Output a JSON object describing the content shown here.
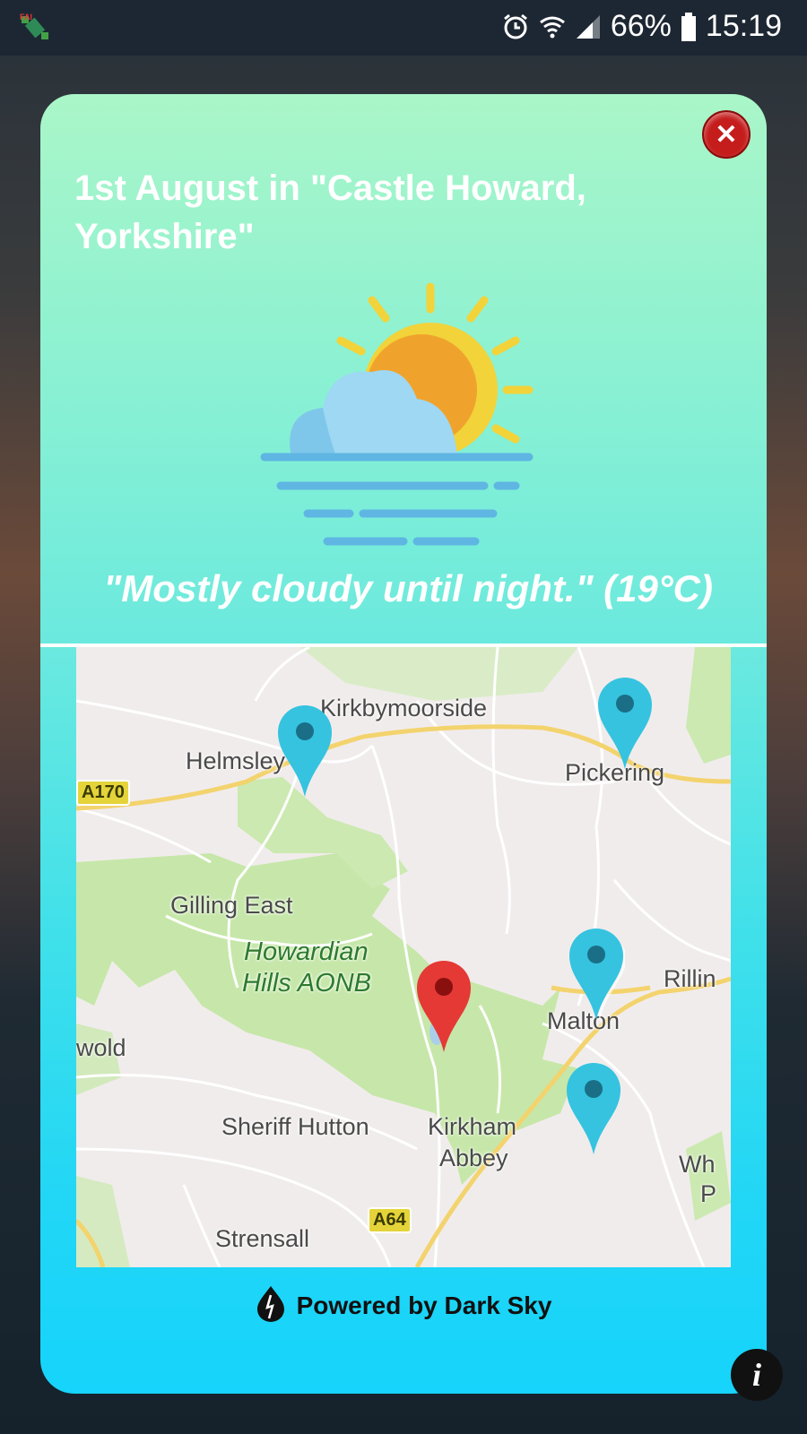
{
  "status_bar": {
    "app_icon": "satellite-icon",
    "alarm_icon": "alarm-clock-icon",
    "wifi_icon": "wifi-icon",
    "signal_icon": "signal-icon",
    "battery_percent": "66%",
    "battery_icon": "battery-icon",
    "time": "15:19"
  },
  "dialog": {
    "title": "1st August in \"Castle Howard, Yorkshire\"",
    "close_icon": "close-icon",
    "weather_icon": "sun-behind-cloud-fog-icon",
    "summary": "\"Mostly cloudy until night.\" (19°C)",
    "powered_by": "Powered by Dark Sky",
    "powered_icon": "dark-sky-logo-icon"
  },
  "map": {
    "places": {
      "kirkbymoorside": "Kirkbymoorside",
      "helmsley": "Helmsley",
      "pickering": "Pickering",
      "gilling_east": "Gilling East",
      "aonb_line1": "Howardian",
      "aonb_line2": "Hills AONB",
      "rillington": "Rillin",
      "malton": "Malton",
      "wold": "wold",
      "sheriff_hutton": "Sheriff Hutton",
      "kirkham_line1": "Kirkham",
      "kirkham_line2": "Abbey",
      "wh_line1": "Wh",
      "wh_line2": "P",
      "strensall": "Strensall"
    },
    "roads": {
      "a170": "A170",
      "a64": "A64"
    },
    "colors": {
      "land": "#f1ecec",
      "green": "#c6e7a9",
      "road": "#f3d36d",
      "pin_blue": "#35c3e0",
      "pin_red": "#e53935"
    }
  },
  "info_button": {
    "label": "i"
  }
}
